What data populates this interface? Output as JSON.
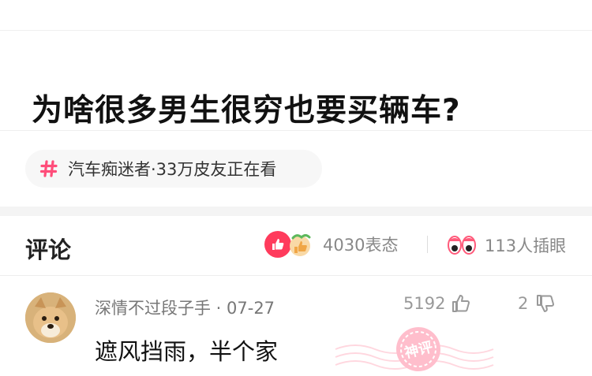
{
  "post": {
    "title": "为啥很多男生很穷也要买辆车?"
  },
  "topic": {
    "text": "汽车痴迷者·33万皮友正在看",
    "icon": "hash-icon",
    "accent_color": "#ff4d7a"
  },
  "comments_section": {
    "title": "评论",
    "reactions_count": "4030表态",
    "eyes_count": "113人插眼",
    "like_color": "#ff3b5c"
  },
  "comment": {
    "username": "深情不过段子手 · 07-27",
    "text": "遮风挡雨，半个家",
    "likes": "5192",
    "replies": "2",
    "badge": "神评"
  }
}
